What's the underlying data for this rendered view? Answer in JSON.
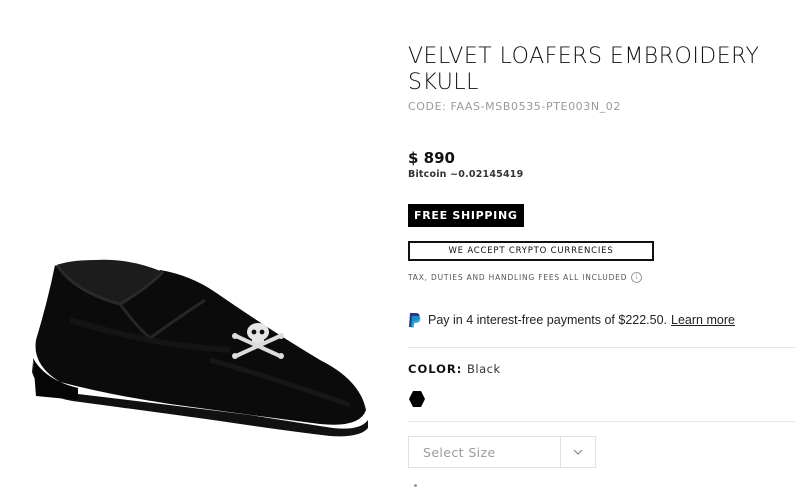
{
  "product": {
    "title": "VELVET LOAFERS EMBROIDERY SKULL",
    "code": "CODE: FAAS-MSB0535-PTE003N_02",
    "price": "$ 890",
    "bitcoin": "Bitcoin ~0.02145419",
    "free_shipping": "FREE SHIPPING",
    "crypto_label": "WE ACCEPT CRYPTO CURRENCIES",
    "tax_note": "TAX, DUTIES AND HANDLING FEES ALL INCLUDED",
    "tax_info_icon": "info-icon"
  },
  "paypal": {
    "icon": "paypal-icon",
    "text": "Pay in 4 interest-free payments of $222.50.",
    "learn_more": "Learn more"
  },
  "color": {
    "label": "COLOR:",
    "value": "Black",
    "swatch_color": "#000000"
  },
  "size": {
    "placeholder": "Select Size",
    "chevron_icon": "chevron-down-icon"
  },
  "image": {
    "alt": "black-velvet-loafer-with-skull-embroidery"
  }
}
